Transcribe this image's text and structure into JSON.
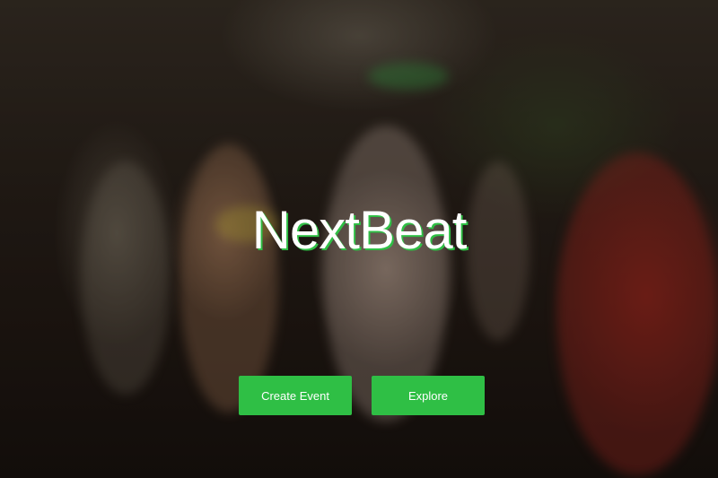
{
  "brand": {
    "title": "NextBeat",
    "accent_color": "#2fbf45"
  },
  "actions": {
    "create_label": "Create Event",
    "explore_label": "Explore"
  },
  "background": {
    "description_icon": "festival-crowd-photo"
  }
}
